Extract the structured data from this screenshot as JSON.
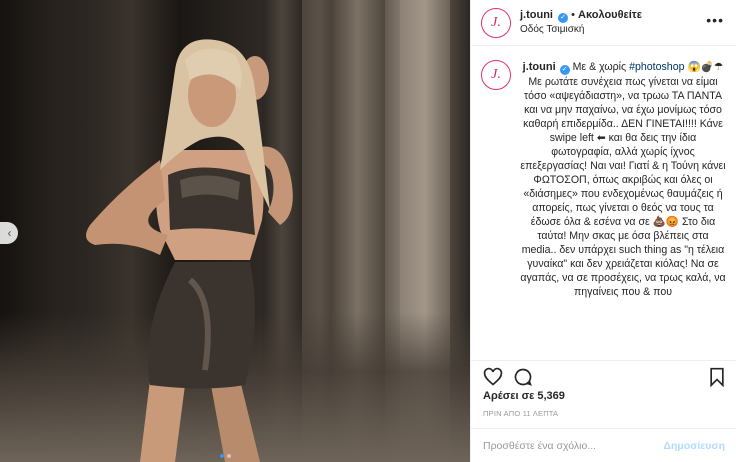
{
  "header": {
    "username": "j.touni",
    "follow_label": "Ακολουθείτε",
    "location": "Οδός Τσιμισκή",
    "avatar_letter": "J."
  },
  "caption": {
    "username": "j.touni",
    "tag_intro": "Με & χωρίς",
    "hashtag": "#photoshop",
    "emoji_line": "😱💣☂",
    "text": "Με ρωτάτε συνέχεια πως γίνεται να είμαι τόσο «αψεγάδιαστη», να τρωω ΤΑ ΠΑΝΤΑ και να μην παχαίνω, να έχω μονίμως τόσο καθαρή επιδερμίδα.. ΔΕΝ ΓΙΝΕΤΑΙ!!!! Κάνε swipe left ⬅ και θα δεις την ίδια φωτογραφία, αλλά χωρίς ίχνος επεξεργασίας! Ναι ναι! Γιατί & η Τούνη κάνει ΦΩΤΟΣΟΠ, όπως ακριβώς και όλες οι «διάσημες» που ενδεχομένως θαυμάζεις ή απορείς, πως γίνεται ο θεός να τους τα έδωσε όλα & εσένα να σε 💩😡 Στο δια ταύτα! Μην σκας με όσα βλέπεις στα media.. δεν υπάρχει such thing as \"η τέλεια γυναίκα\" και δεν χρειάζεται κιόλας! Να σε αγαπάς, να σε προσέχεις, να τρως καλά, να πηγαίνεις που & που"
  },
  "likes_text": "Αρέσει σε 5,369",
  "timestamp": "ΠΡΙΝ ΑΠΟ 11 ΛΕΠΤΑ",
  "comment": {
    "placeholder": "Προσθέστε ένα σχόλιο...",
    "post_label": "Δημοσίευση"
  },
  "carousel": {
    "slide_count": 2,
    "active_index": 0
  },
  "colors": {
    "accent": "#3897f0",
    "brand": "#d4266f",
    "post_disabled": "#b3dbff"
  },
  "icons": [
    "verified-icon",
    "more-icon",
    "heart-icon",
    "comment-icon",
    "bookmark-icon",
    "chevron-left-icon"
  ]
}
